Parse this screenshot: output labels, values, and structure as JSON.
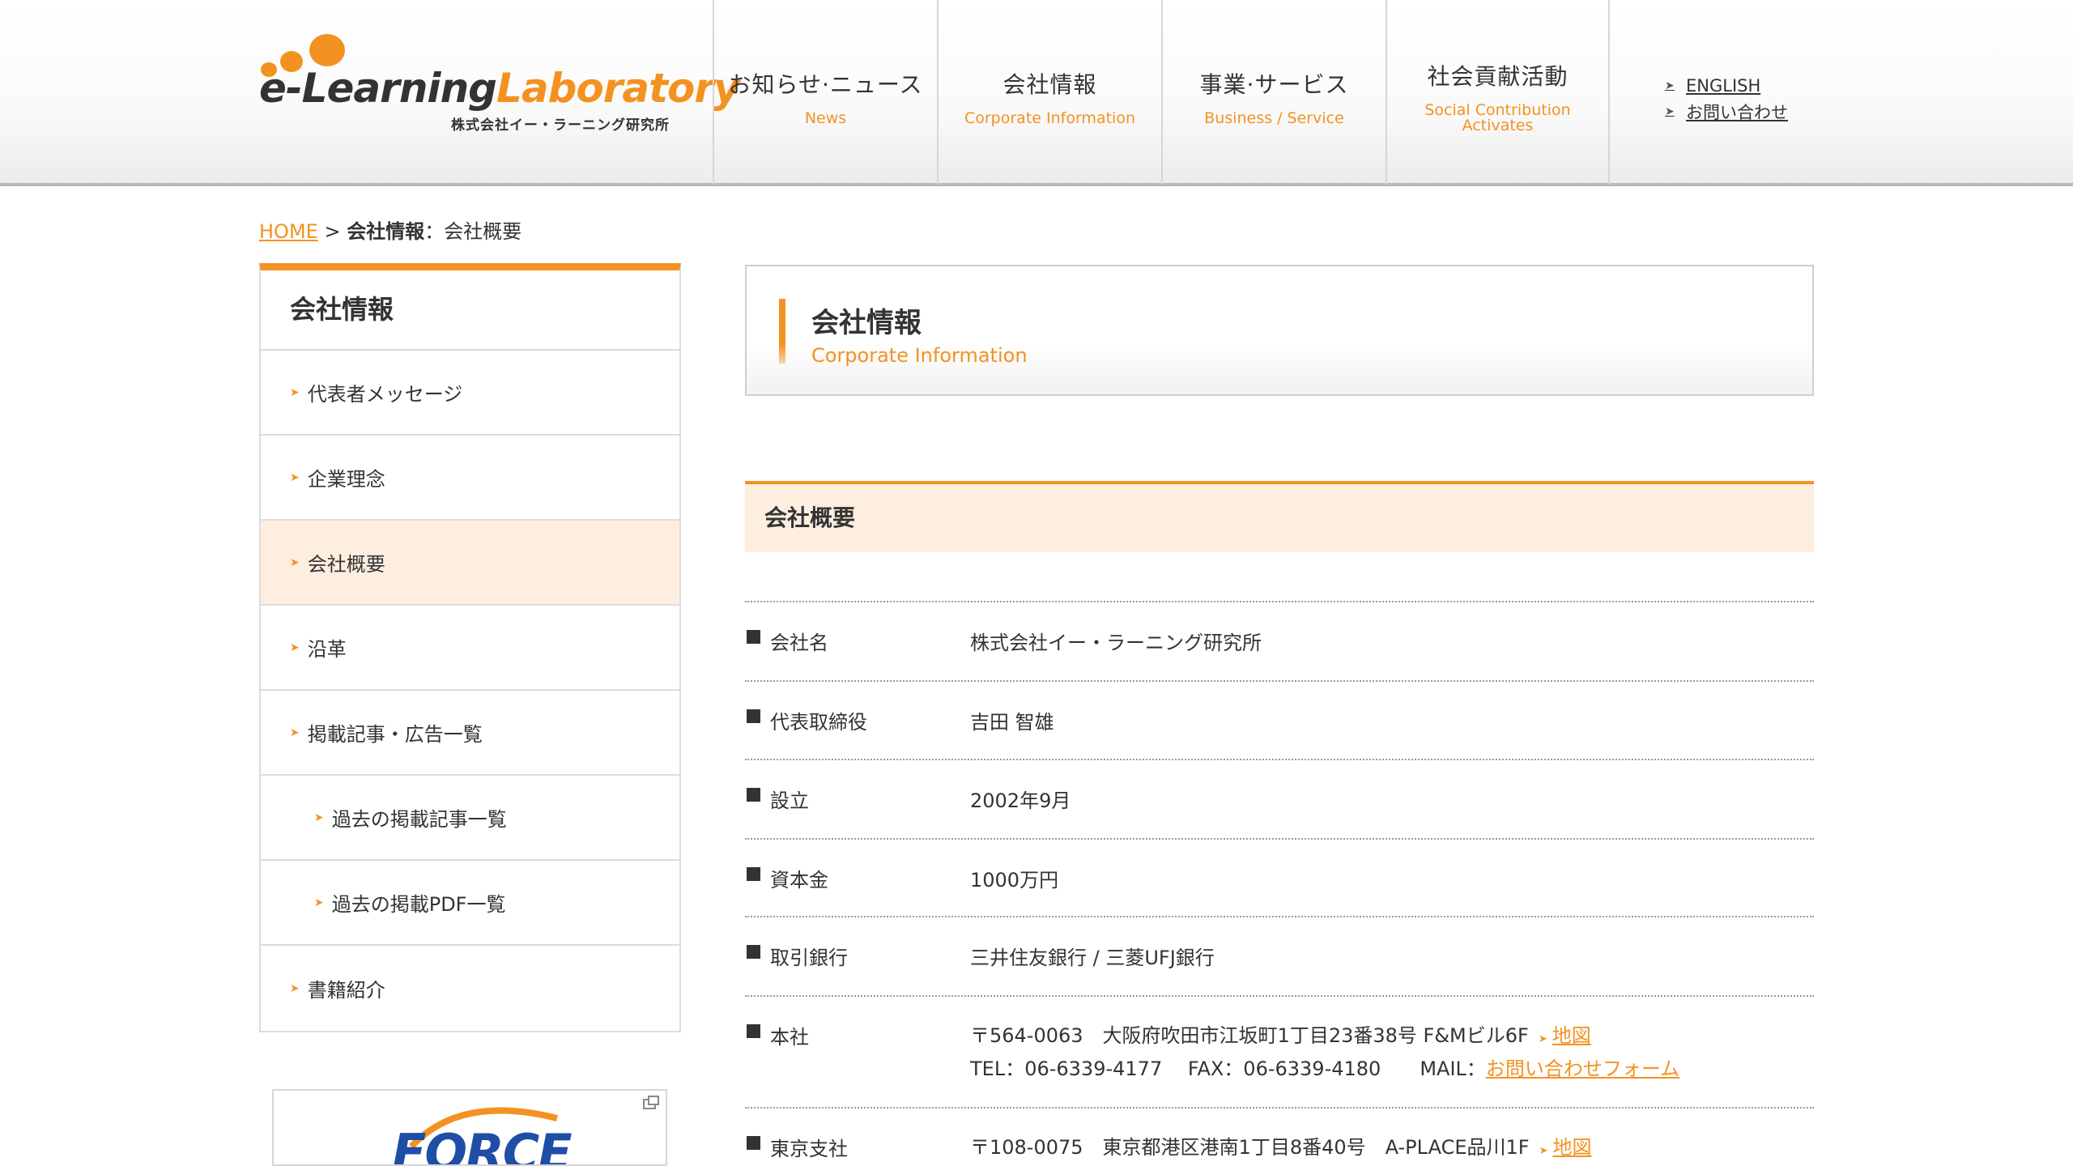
{
  "header": {
    "logo": {
      "word1": "e-Learning",
      "word2": "Laboratory",
      "company": "株式会社イー・ラーニング研究所"
    },
    "nav": [
      {
        "ja": "お知らせ·ニュース",
        "en": "News"
      },
      {
        "ja": "会社情報",
        "en": "Corporate Information"
      },
      {
        "ja": "事業·サービス",
        "en": "Business / Service"
      },
      {
        "ja": "社会貢献活動",
        "en": "Social   Contribution\nActivates"
      }
    ],
    "utility": [
      {
        "label": "ENGLISH"
      },
      {
        "label": "お問い合わせ"
      }
    ]
  },
  "breadcrumb": {
    "home": "HOME",
    "sep": " > ",
    "section": "会社情報",
    "colon": "：",
    "current": "会社概要"
  },
  "sidebar": {
    "title": "会社情報",
    "items": [
      {
        "label": "代表者メッセージ"
      },
      {
        "label": "企業理念"
      },
      {
        "label": "会社概要"
      },
      {
        "label": "沿革"
      },
      {
        "label": "掲載記事・広告一覧"
      },
      {
        "label": "過去の掲載記事一覧"
      },
      {
        "label": "過去の掲載PDF一覧"
      },
      {
        "label": "書籍紹介"
      }
    ],
    "banner_text": "FORCE"
  },
  "page_head": {
    "title": "会社情報",
    "subtitle": "Corporate Information"
  },
  "section": {
    "title": "会社概要"
  },
  "info": {
    "rows": [
      {
        "label": "会社名",
        "value": "株式会社イー・ラーニング研究所"
      },
      {
        "label": "代表取締役",
        "value": "吉田 智雄"
      },
      {
        "label": "設立",
        "value": "2002年9月"
      },
      {
        "label": "資本金",
        "value": "1000万円"
      },
      {
        "label": "取引銀行",
        "value": "三井住友銀行 / 三菱UFJ銀行"
      },
      {
        "label": "本社",
        "address": "〒564-0063　大阪府吹田市江坂町1丁目23番38号 F&Mビル6F",
        "map": "地図",
        "contact": "TEL：06-6339-4177　 FAX：06-6339-4180　　MAIL：",
        "mail_link": "お問い合わせフォーム"
      },
      {
        "label": "東京支社",
        "address": "〒108-0075　東京都港区港南1丁目8番40号　A-PLACE品川1F",
        "map": "地図"
      }
    ]
  },
  "colors": {
    "accent": "#f39221",
    "accent_light": "#fdeee0",
    "text": "#333333",
    "border": "#dcdcdc",
    "banner_blue": "#1f4ea6"
  }
}
